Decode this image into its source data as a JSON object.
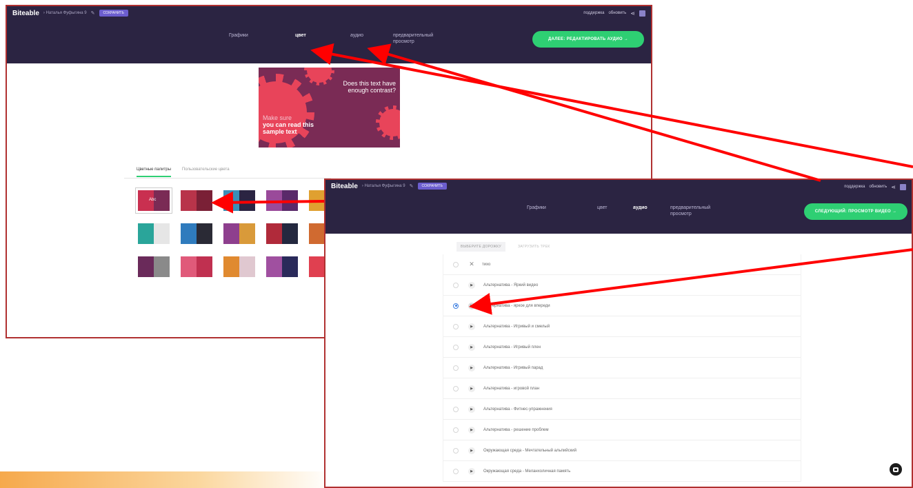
{
  "app": {
    "logo": "Biteable",
    "breadcrumb": "Наталья Фуфыгина 9",
    "save_label": "СОХРАНИТЬ",
    "support": "поддержка",
    "upgrade": "обновить",
    "share_icon": "share-icon",
    "user_icon": "user-icon"
  },
  "screen1": {
    "steps": [
      "Графики",
      "цвет",
      "аудио",
      "предварительный просмотр"
    ],
    "active_step": "цвет",
    "next_button": "ДАЛЕЕ: РЕДАКТИРОВАТЬ АУДИО →",
    "preview": {
      "contrast_question": "Does this text have enough contrast?",
      "sample_line1": "Make sure",
      "sample_line2": "you can read this sample text"
    },
    "palette_tabs": [
      "Цветные палитры",
      "Пользовательские цвета"
    ],
    "swatch_label": "Abc",
    "palettes": [
      [
        "#c93050",
        "#7a2b55"
      ],
      [
        "#b8344a",
        "#7a2036"
      ],
      [
        "#3a8fb7",
        "#2b2442"
      ],
      [
        "#9a4a9a",
        "#5a2a6a"
      ],
      [
        "#e0a030",
        "#d06020"
      ],
      [
        "#2aa59a",
        "#e6e6e6"
      ],
      [
        "#2f7bbd",
        "#2a2a35"
      ],
      [
        "#8e3f8e",
        "#d99a3a"
      ],
      [
        "#b02a3a",
        "#24283f"
      ],
      [
        "#d06a30",
        "#f0a050"
      ],
      [
        "#6a2a5a",
        "#8a8a8a"
      ],
      [
        "#e05a7a",
        "#c03050"
      ],
      [
        "#e08a30",
        "#e0c8d0"
      ],
      [
        "#a050a0",
        "#2a2a5a"
      ],
      [
        "#e04050",
        "#7a2b55"
      ]
    ]
  },
  "screen2": {
    "steps": [
      "Графики",
      "цвет",
      "аудио",
      "предварительный просмотр"
    ],
    "active_step": "аудио",
    "next_button": "СЛЕДУЮЩИЙ: ПРОСМОТР ВИДЕО →",
    "sub_tabs": [
      "ВЫБЕРИТЕ ДОРОЖКУ",
      "ЗАГРУЗИТЬ ТРЕК"
    ],
    "tracks": [
      "тихо",
      "Альтернатива - Яркий видео",
      "Альтернатива - яркое для впереди",
      "Альтернатива - Игривый и смелый",
      "Альтернатива - Игривый плен",
      "Альтернатива - Игривый парад",
      "Альтернатива - игровой план",
      "Альтернатива - Фитнес-упражнения",
      "Альтернатива - решение проблем",
      "Окружающая среда - Мечтательный альпийский",
      "Окружающая среда - Меланхоличная память"
    ],
    "selected_track": 2,
    "chat_icon": "chat-icon"
  },
  "colors": {
    "nav_bg": "#2b2442",
    "accent_green": "#2ecf73",
    "annotation_red": "#ff0000",
    "frame_red": "#b03030"
  }
}
